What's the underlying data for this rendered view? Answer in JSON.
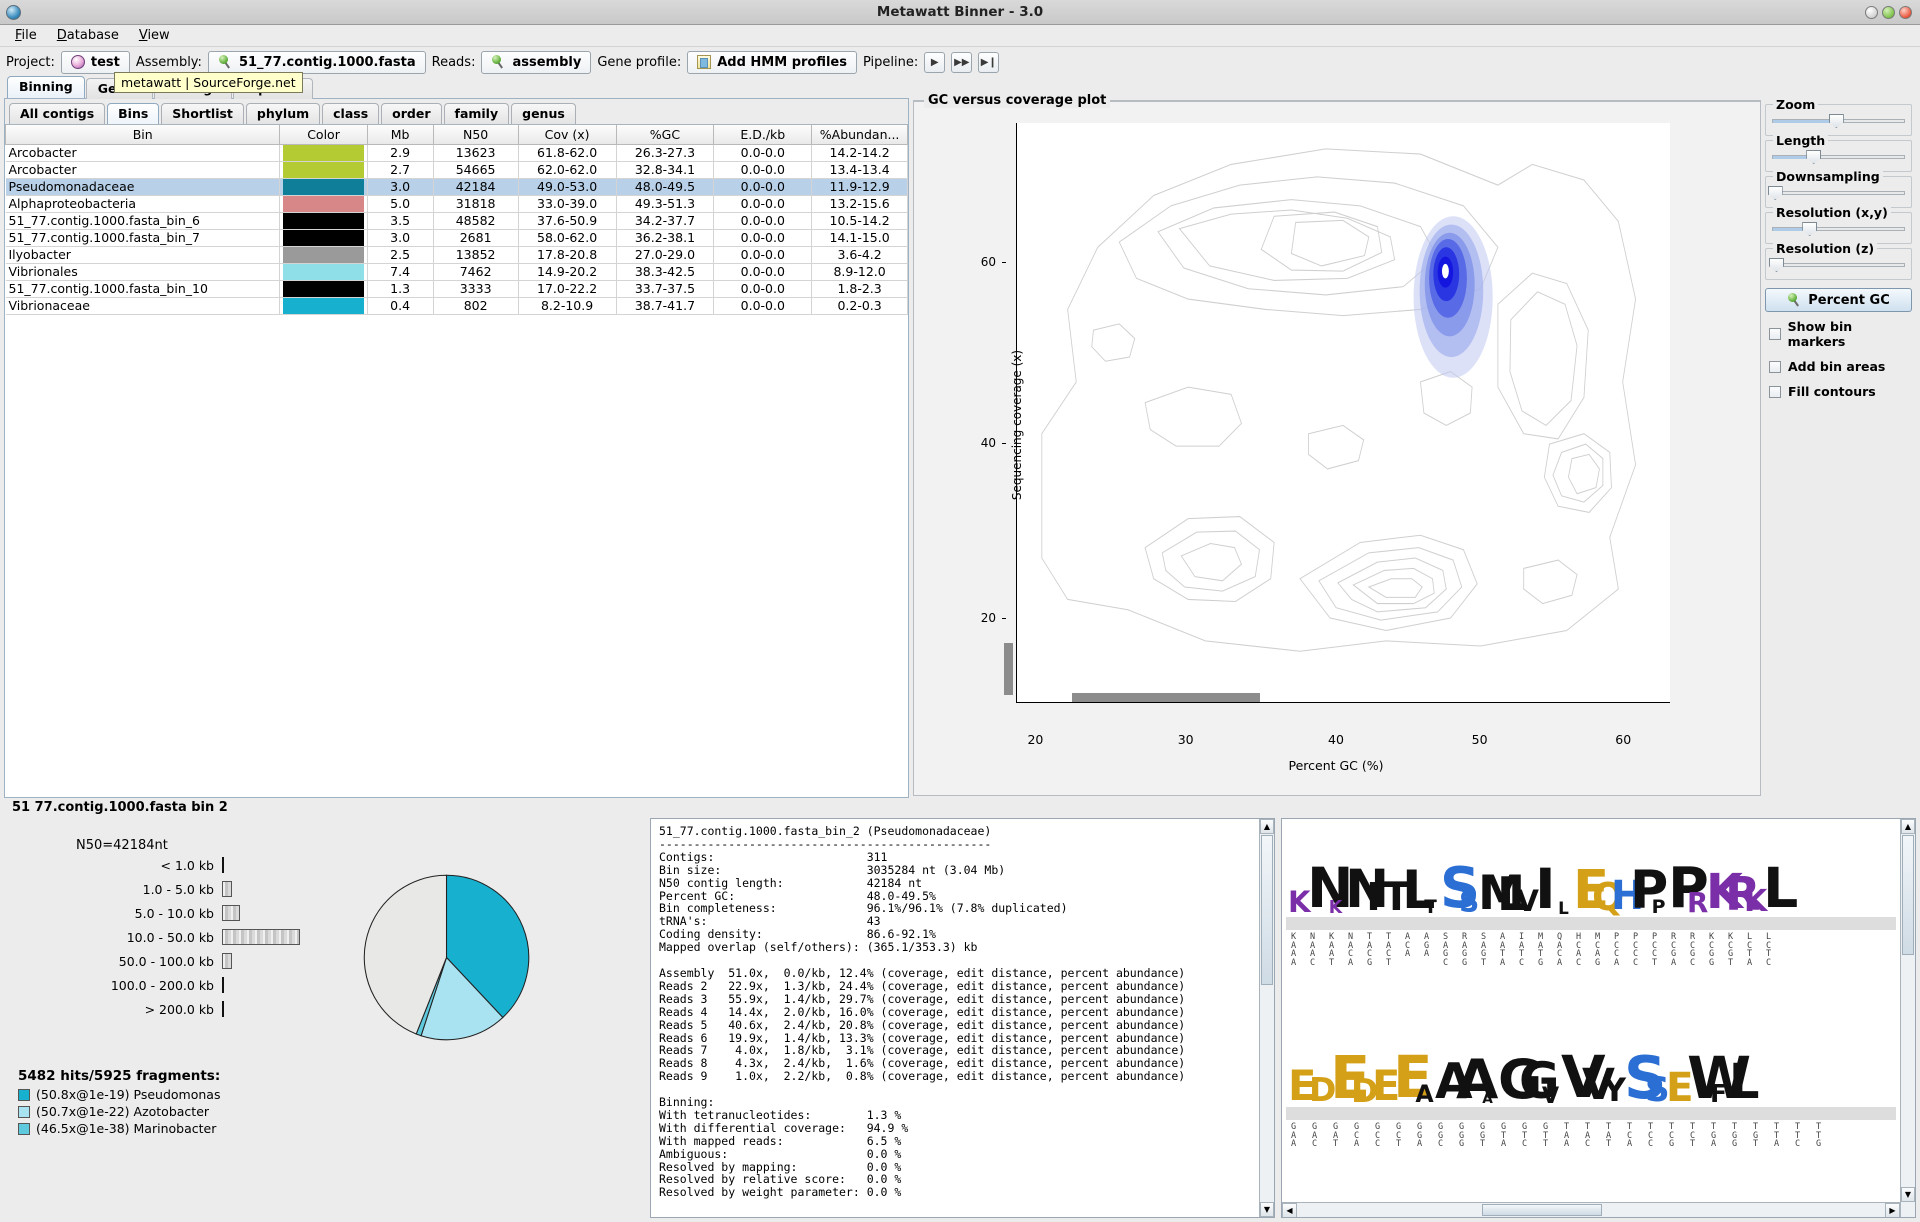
{
  "window": {
    "title": "Metawatt Binner - 3.0"
  },
  "menu": {
    "items": [
      "File",
      "Database",
      "View"
    ]
  },
  "toolbar": {
    "project_label": "Project:",
    "project_value": "test",
    "assembly_label": "Assembly:",
    "assembly_value": "51_77.contig.1000.fasta",
    "reads_label": "Reads:",
    "reads_value": "assembly",
    "gene_profile_label": "Gene profile:",
    "gene_profile_value": "Add HMM profiles",
    "pipeline_label": "Pipeline:",
    "pipeline_buttons": [
      "▶",
      "▶▶",
      "▶❙"
    ],
    "tooltip": "metawatt | SourceForge.net"
  },
  "top_tabs": [
    {
      "label": "Binning",
      "selected": true
    },
    {
      "label": "Genes",
      "selected": false
    },
    {
      "label": "Contigs",
      "selected": false
    },
    {
      "label": "Pipeline",
      "selected": false
    }
  ],
  "sub_tabs": [
    {
      "label": "All contigs",
      "selected": false
    },
    {
      "label": "Bins",
      "selected": true
    },
    {
      "label": "Shortlist",
      "selected": false
    },
    {
      "label": "phylum",
      "selected": false
    },
    {
      "label": "class",
      "selected": false
    },
    {
      "label": "order",
      "selected": false
    },
    {
      "label": "family",
      "selected": false
    },
    {
      "label": "genus",
      "selected": false
    }
  ],
  "table": {
    "columns": [
      "Bin",
      "Color",
      "Mb",
      "N50",
      "Cov (x)",
      "%GC",
      "E.D./kb",
      "%Abundan..."
    ],
    "rows": [
      {
        "bin": "Arcobacter",
        "color": "#b5cb33",
        "mb": "2.9",
        "n50": "13623",
        "cov": "61.8-62.0",
        "gc": "26.3-27.3",
        "ed": "0.0-0.0",
        "abundance": "14.2-14.2",
        "selected": false
      },
      {
        "bin": "Arcobacter",
        "color": "#b5cb33",
        "mb": "2.7",
        "n50": "54665",
        "cov": "62.0-62.0",
        "gc": "32.8-34.1",
        "ed": "0.0-0.0",
        "abundance": "13.4-13.4",
        "selected": false
      },
      {
        "bin": "Pseudomonadaceae",
        "color": "#0e7e99",
        "mb": "3.0",
        "n50": "42184",
        "cov": "49.0-53.0",
        "gc": "48.0-49.5",
        "ed": "0.0-0.0",
        "abundance": "11.9-12.9",
        "selected": true
      },
      {
        "bin": "Alphaproteobacteria",
        "color": "#d78787",
        "mb": "5.0",
        "n50": "31818",
        "cov": "33.0-39.0",
        "gc": "49.3-51.3",
        "ed": "0.0-0.0",
        "abundance": "13.2-15.6",
        "selected": false
      },
      {
        "bin": "51_77.contig.1000.fasta_bin_6",
        "color": "#000000",
        "mb": "3.5",
        "n50": "48582",
        "cov": "37.6-50.9",
        "gc": "34.2-37.7",
        "ed": "0.0-0.0",
        "abundance": "10.5-14.2",
        "selected": false
      },
      {
        "bin": "51_77.contig.1000.fasta_bin_7",
        "color": "#000000",
        "mb": "3.0",
        "n50": "2681",
        "cov": "58.0-62.0",
        "gc": "36.2-38.1",
        "ed": "0.0-0.0",
        "abundance": "14.1-15.0",
        "selected": false
      },
      {
        "bin": "Ilyobacter",
        "color": "#9a9a9a",
        "mb": "2.5",
        "n50": "13852",
        "cov": "17.8-20.8",
        "gc": "27.0-29.0",
        "ed": "0.0-0.0",
        "abundance": "3.6-4.2",
        "selected": false
      },
      {
        "bin": "Vibrionales",
        "color": "#8fdfe8",
        "mb": "7.4",
        "n50": "7462",
        "cov": "14.9-20.2",
        "gc": "38.3-42.5",
        "ed": "0.0-0.0",
        "abundance": "8.9-12.0",
        "selected": false
      },
      {
        "bin": "51_77.contig.1000.fasta_bin_10",
        "color": "#000000",
        "mb": "1.3",
        "n50": "3333",
        "cov": "17.0-22.2",
        "gc": "33.7-37.5",
        "ed": "0.0-0.0",
        "abundance": "1.8-2.3",
        "selected": false
      },
      {
        "bin": "Vibrionaceae",
        "color": "#17b0cf",
        "mb": "0.4",
        "n50": "802",
        "cov": "8.2-10.9",
        "gc": "38.7-41.7",
        "ed": "0.0-0.0",
        "abundance": "0.2-0.3",
        "selected": false
      }
    ]
  },
  "chart_data": {
    "type": "heatmap",
    "title": "GC versus coverage plot",
    "xlabel": "Percent GC (%)",
    "ylabel": "Sequencing coverage (x)",
    "xticks": [
      20,
      30,
      40,
      50,
      60
    ],
    "yticks": [
      20,
      40,
      60
    ],
    "xlim": [
      16.5,
      64.5
    ],
    "ylim": [
      4,
      72
    ],
    "grid": false,
    "legend": "none",
    "description": "Contour density plot of contigs; a highlighted blue density peak is centered near 50% GC / 51x coverage corresponding to the selected Pseudomonadaceae bin.",
    "highlight_peak": {
      "gc": 50.0,
      "coverage": 51.0,
      "color": "#1515e0"
    },
    "contour_peaks": [
      {
        "gc": 28.5,
        "coverage": 62.0
      },
      {
        "gc": 34.0,
        "coverage": 62.0
      },
      {
        "gc": 50.0,
        "coverage": 51.0
      },
      {
        "gc": 51.5,
        "coverage": 36.0
      },
      {
        "gc": 28.5,
        "coverage": 20.0
      },
      {
        "gc": 40.5,
        "coverage": 18.5
      }
    ]
  },
  "controls": {
    "sliders": [
      {
        "label": "Zoom",
        "value": 48
      },
      {
        "label": "Length",
        "value": 31
      },
      {
        "label": "Downsampling",
        "value": 2
      },
      {
        "label": "Resolution (x,y)",
        "value": 28
      },
      {
        "label": "Resolution (z)",
        "value": 3
      }
    ],
    "percent_gc_button": "Percent GC",
    "checkboxes": [
      {
        "label": "Show bin markers",
        "checked": false
      },
      {
        "label": "Add bin areas",
        "checked": false
      },
      {
        "label": "Fill contours",
        "checked": false
      }
    ]
  },
  "bottom": {
    "title": "51 77.contig.1000.fasta bin 2",
    "histogram": {
      "n50_label": "N50=42184nt",
      "bins": [
        {
          "label": "< 1.0 kb",
          "width": 2
        },
        {
          "label": "1.0 - 5.0 kb",
          "width": 10
        },
        {
          "label": "5.0 - 10.0 kb",
          "width": 18
        },
        {
          "label": "10.0 - 50.0 kb",
          "width": 78
        },
        {
          "label": "50.0 - 100.0 kb",
          "width": 10
        },
        {
          "label": "100.0 - 200.0 kb",
          "width": 2
        },
        {
          "label": "> 200.0 kb",
          "width": 2
        }
      ]
    },
    "pie": {
      "title": "5482 hits/5925 fragments:",
      "slices": [
        {
          "label": "(50.8x@1e-19) Pseudomonas",
          "color": "#17b0cf",
          "percent": 38
        },
        {
          "label": "(50.7x@1e-22) Azotobacter",
          "color": "#a9e2f0",
          "percent": 17
        },
        {
          "label": "(46.5x@1e-38) Marinobacter",
          "color": "#5fc9de",
          "percent": 1
        },
        {
          "label": "",
          "color": "#e8e8e6",
          "percent": 44
        }
      ]
    },
    "report": "51_77.contig.1000.fasta_bin_2 (Pseudomonadaceae)\n------------------------------------------------\nContigs:                      311\nBin size:                     3035284 nt (3.04 Mb)\nN50 contig length:            42184 nt\nPercent GC:                   48.0-49.5%\nBin completeness:             96.1%/96.1% (7.8% duplicated)\ntRNA's:                       43\nCoding density:               86.6-92.1%\nMapped overlap (self/others): (365.1/353.3) kb\n\nAssembly  51.0x,  0.0/kb, 12.4% (coverage, edit distance, percent abundance)\nReads 2   22.9x,  1.3/kb, 24.4% (coverage, edit distance, percent abundance)\nReads 3   55.9x,  1.4/kb, 29.7% (coverage, edit distance, percent abundance)\nReads 4   14.4x,  2.0/kb, 16.0% (coverage, edit distance, percent abundance)\nReads 5   40.6x,  2.4/kb, 20.8% (coverage, edit distance, percent abundance)\nReads 6   19.9x,  1.4/kb, 13.3% (coverage, edit distance, percent abundance)\nReads 7    4.0x,  1.8/kb,  3.1% (coverage, edit distance, percent abundance)\nReads 8    4.3x,  2.4/kb,  1.6% (coverage, edit distance, percent abundance)\nReads 9    1.0x,  2.2/kb,  0.8% (coverage, edit distance, percent abundance)\n\nBinning:\nWith tetranucleotides:        1.3 %\nWith differential coverage:   94.9 %\nWith mapped reads:            6.5 %\nAmbiguous:                    0.0 %\nResolved by mapping:          0.0 %\nResolved by relative score:   0.0 %\nResolved by weight parameter: 0.0 %",
    "sequence_logo": {
      "row1_protein": [
        "K",
        "N",
        "K",
        "N",
        "I",
        "T",
        "L",
        "T",
        "S",
        "S",
        "M",
        "L",
        "V",
        "I",
        "L",
        "E",
        "Q",
        "H",
        "P",
        "P",
        "P",
        "R",
        "K",
        "R",
        "K",
        "L"
      ],
      "row1_dna": [
        "KAAA",
        "NAAC",
        "KAAT",
        "NACA",
        "TACG",
        "TACT",
        "ACA",
        "AGA",
        "SAGC",
        "RAGG",
        "SAGT",
        "AATA",
        "IATC",
        "MATG",
        "QACA",
        "HCAC",
        "MCAG",
        "PCCA",
        "PCCC",
        "PCCT",
        "RCGA",
        "RCGC",
        "KCGG",
        "KCGT",
        "LCTA",
        "LCTC"
      ],
      "row2_protein": [
        "E",
        "D",
        "E",
        "D",
        "E",
        "E",
        "A",
        "A",
        "A",
        "A",
        "G",
        "G",
        "V",
        "V",
        "V",
        "Y",
        "S",
        "S",
        "E",
        "W",
        "F",
        "L"
      ],
      "row2_dna": [
        "GAA",
        "GAC",
        "GAT",
        "GCA",
        "GCC",
        "GCT",
        "GGA",
        "GGC",
        "GGG",
        "GGT",
        "GTA",
        "GTC",
        "GTT",
        "TAA",
        "TAC",
        "TAT",
        "TCA",
        "TCC",
        "TCG",
        "TCT",
        "TGA",
        "TGG",
        "TGT",
        "TTA",
        "TTC",
        "TTG"
      ]
    }
  }
}
